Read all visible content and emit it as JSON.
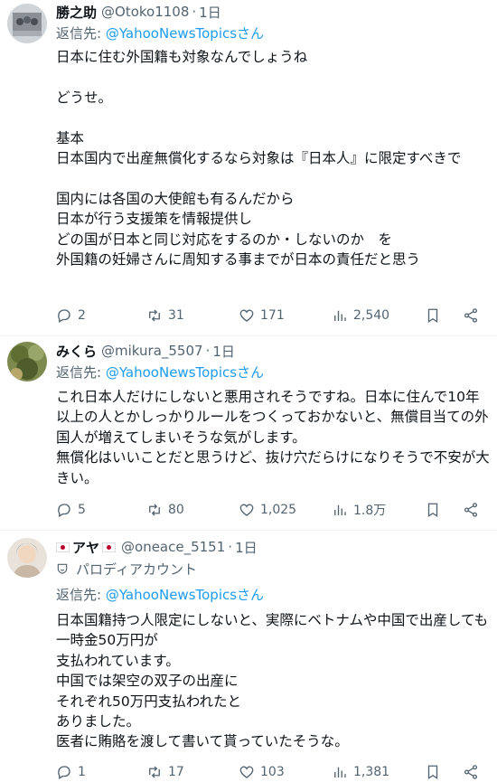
{
  "tweets": [
    {
      "name": "勝之助",
      "handle": "@Otoko1108",
      "time": "1日",
      "reply_prefix": "返信先: ",
      "reply_to": "@YahooNewsTopicsさん",
      "body": "日本に住む外国籍も対象なんでしょうね\n\nどうせ。\n\n基本\n日本国内で出産無償化するなら対象は『日本人』に限定すべきで\n\n国内には各国の大使館も有るんだから\n日本が行う支援策を情報提供し\nどの国が日本と同じ対応をするのか・しないのか　を\n外国籍の妊婦さんに周知する事までが日本の責任だと思う",
      "replies": "2",
      "retweets": "31",
      "likes": "171",
      "views": "2,540"
    },
    {
      "name": "みくら",
      "handle": "@mikura_5507",
      "time": "1日",
      "reply_prefix": "返信先: ",
      "reply_to": "@YahooNewsTopicsさん",
      "body": "これ日本人だけにしないと悪用されそうですね。日本に住んで10年以上の人とかしっかりルールをつくっておかないと、無償目当ての外国人が増えてしまいそうな気がします。\n無償化はいいことだと思うけど、抜け穴だらけになりそうで不安が大きい。",
      "replies": "5",
      "retweets": "80",
      "likes": "1,025",
      "views": "1.8万"
    },
    {
      "name": "アヤ",
      "handle": "@oneace_5151",
      "time": "1日",
      "parody_label": "パロディアカウント",
      "reply_prefix": "返信先: ",
      "reply_to": "@YahooNewsTopicsさん",
      "body": "日本国籍持つ人限定にしないと、実際にベトナムや中国で出産しても一時金50万円が\n支払われています。\n中国では架空の双子の出産に\nそれぞれ50万円支払われたと\nありました。\n医者に賄賂を渡して書いて貰っていたそうな。",
      "replies": "1",
      "retweets": "17",
      "likes": "103",
      "views": "1,381"
    }
  ],
  "icons": [
    "reply-icon",
    "retweet-icon",
    "like-icon",
    "views-icon",
    "bookmark-icon",
    "share-icon",
    "parody-icon"
  ],
  "colors": {
    "link": "#1d9bf0",
    "muted": "#536471",
    "text": "#0f1419",
    "flag_red": "#bc002d"
  }
}
